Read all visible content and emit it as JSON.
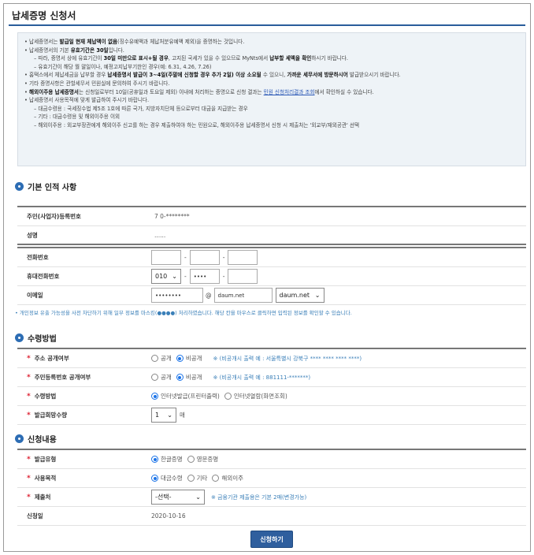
{
  "page_title": "납세증명 신청서",
  "notice": {
    "l1a": "납세증명서는 ",
    "l1b": "발급일 현재 체납액이 없음",
    "l1c": "(징수유예액과 체납처분유예액 제외)을 증명하는 것입니다.",
    "l2a": "납세증명서의 기본 ",
    "l2b": "유효기간은 30일",
    "l2c": "입니다.",
    "l3a": "– 따라, 증명서 상에 유효기간이 ",
    "l3b": "30일 미만으로 표시+될 경우",
    "l3c": ", 고지된 국세가 있을 수 있으므로 MyNts에서 ",
    "l3d": "납부할 세액을 확인",
    "l3e": "하시기 바랍니다.",
    "l4": "– 유효기간이 해당 월 말일이나, 예정고지납부기한인 경우(예: 6.31, 4.26, 7.26)",
    "l5a": "홈택스에서 체납세금을 납부할 경우 ",
    "l5b": "납세증명서 발급이 3~4일(주말에 신청할 경우 추가 2일) 이상 소요될",
    "l5c": " 수 있으니, ",
    "l5d": "가까운 세무서에 방문하시어",
    "l5e": " 발급받으시기 바랍니다.",
    "l6": "기타 증명사항은 관할세무서 민원실에 문의하여 주시기 바랍니다.",
    "l7a": "해외이주용 납세증명서",
    "l7b": "는 신청일로부터 10일(공휴일과 토요일 제외) 이내에 처리하는 증명으로 신청 결과는 ",
    "l7c": "민원 신청처리결과 조회",
    "l7d": "에서 확인하실 수 있습니다.",
    "l8": "납세증명서 사용목적에 맞게 발급하여 주시기 바랍니다.",
    "l9": "– 대금수령용 : 국세징수법 제5조 1호에 따른 국가, 지방자치단체 등으로부터 대금을 지급받는 경우",
    "l10": "– 기타 : 대금수령용 및 해외이주용 이외",
    "l11": "– 해외이주용 : 외교부장관에게 해외이주 신고를 하는 경우 제출하여야 하는 민원으로, 해외이주용 납세증명서 신청 시 제출처는 '외교부/재외공관' 선택"
  },
  "basic": {
    "header": "기본 인적 사항",
    "id_label": "주민(사업자)등록번호",
    "id_value": "7      0-********",
    "name_label": "성명",
    "name_value": "......",
    "phone_label": "전화번호",
    "mobile_label": "휴대전화번호",
    "mobile_prefix": "010",
    "mobile_mid": "••••",
    "email_label": "이메일",
    "email_user": "••••••••",
    "email_at": "@",
    "email_domain": "daum.net",
    "email_select": "daum.net"
  },
  "privacy_note": "• 개인정보 유출 가능성을 사전 차단하기 위해 일부 정보를 마스킹(●●●●) 처리하였습니다. 해당 칸을 마우스로 클릭하면 입력된 정보를 확인할 수 있습니다.",
  "receive": {
    "header": "수령방법",
    "addr_label": "주소 공개여부",
    "addr_opt1": "공개",
    "addr_opt2": "비공개",
    "addr_note": "※ (비공개시 출력 예 : 서울특별시 강북구 **** **** **** ****)",
    "rrn_label": "주민등록번호 공개여부",
    "rrn_opt1": "공개",
    "rrn_opt2": "비공개",
    "rrn_note": "※ (비공개시 출력 예 : 881111-*******)",
    "method_label": "수령방법",
    "method_opt1": "인터넷발급(프린터출력)",
    "method_opt2": "인터넷열람(화면조회)",
    "qty_label": "발급희망수량",
    "qty_value": "1",
    "qty_unit": "매"
  },
  "apply": {
    "header": "신청내용",
    "type_label": "발급유형",
    "type_opt1": "한글증명",
    "type_opt2": "영문증명",
    "purpose_label": "사용목적",
    "purpose_opt1": "대금수령",
    "purpose_opt2": "기타",
    "purpose_opt3": "해외이주",
    "submit_to_label": "제출처",
    "submit_to_value": "-선택-",
    "submit_to_note": "※ 금융기관 제출용은 기본 2매(변경가능)",
    "date_label": "신청일",
    "date_value": "2020-10-16"
  },
  "submit_label": "신청하기",
  "colors": {
    "accent": "#2f5f9e",
    "required": "#d23333",
    "note": "#3a7fb8"
  }
}
